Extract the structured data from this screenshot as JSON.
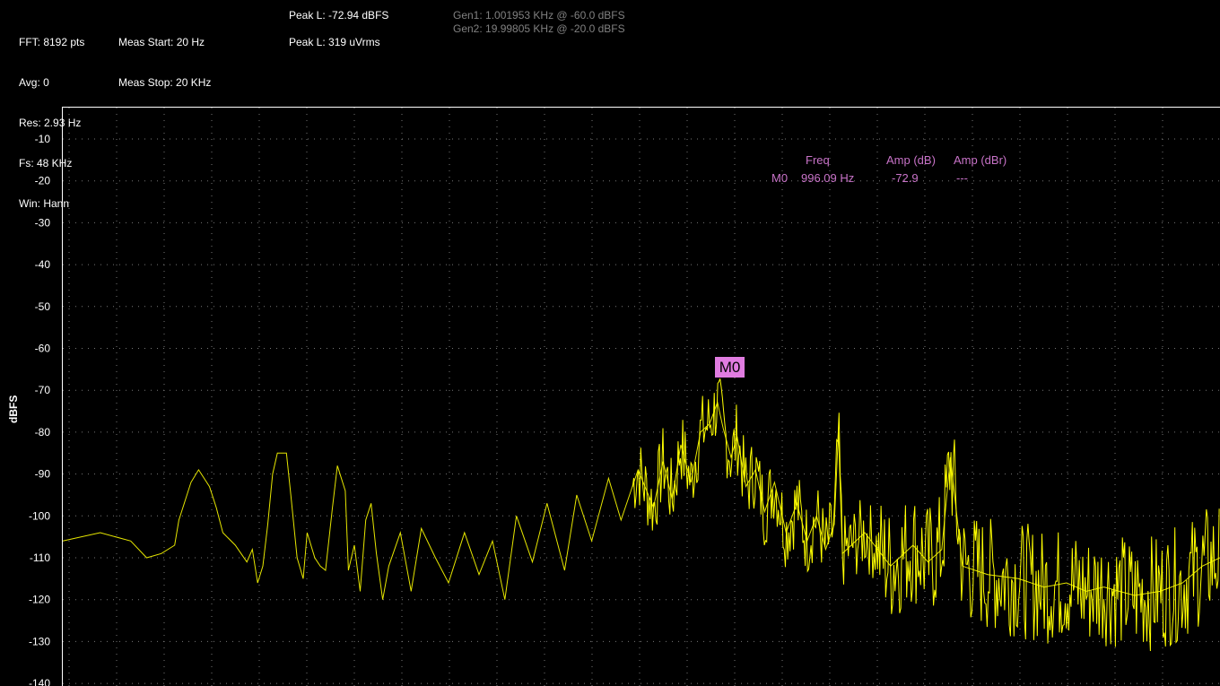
{
  "header": {
    "col1": [
      "FFT: 8192 pts",
      "Avg: 0",
      "Res: 2.93 Hz",
      "Fs: 48 KHz",
      "Win: Hann"
    ],
    "col2": [
      "Meas Start: 20 Hz",
      "Meas Stop: 20 KHz"
    ],
    "peak_dbfs": "Peak L: -72.94 dBFS",
    "peak_vrms": "Peak L: 319 uVrms",
    "gen1": "Gen1: 1.001953 KHz @ -60.0 dBFS",
    "gen2": "Gen2: 19.99805 KHz @ -20.0 dBFS"
  },
  "marker_table": {
    "h_freq": "Freq",
    "h_amp_db": "Amp (dB)",
    "h_amp_dbr": "Amp (dBr)",
    "row_id": "M0",
    "row_freq": "996.09 Hz",
    "row_amp_db": "-72.9",
    "row_amp_dbr": "---"
  },
  "marker_label": "M0",
  "chart_data": {
    "type": "line",
    "ylabel": "dBFS",
    "ylim": [
      -140,
      -2
    ],
    "x_scale": "log",
    "xlim_hz": [
      20,
      20000
    ],
    "y_ticks": [
      -10,
      -20,
      -30,
      -40,
      -50,
      -60,
      -70,
      -80,
      -90,
      -100,
      -110,
      -120,
      -130,
      -140
    ],
    "grid": true,
    "series": [
      {
        "color": "#ffff00",
        "points_hz_db": [
          [
            20,
            -106
          ],
          [
            25,
            -104
          ],
          [
            30,
            -106
          ],
          [
            33,
            -110
          ],
          [
            36,
            -109
          ],
          [
            39,
            -107
          ],
          [
            40,
            -101
          ],
          [
            43,
            -92
          ],
          [
            45,
            -89
          ],
          [
            48,
            -93
          ],
          [
            50,
            -98
          ],
          [
            52,
            -104
          ],
          [
            56,
            -107
          ],
          [
            60,
            -111
          ],
          [
            62,
            -108
          ],
          [
            64,
            -116
          ],
          [
            66,
            -112
          ],
          [
            68,
            -102
          ],
          [
            70,
            -90
          ],
          [
            72,
            -85
          ],
          [
            76,
            -85
          ],
          [
            78,
            -95
          ],
          [
            81,
            -110
          ],
          [
            84,
            -115
          ],
          [
            86,
            -104
          ],
          [
            90,
            -110
          ],
          [
            93,
            -112
          ],
          [
            96,
            -113
          ],
          [
            100,
            -98
          ],
          [
            103,
            -88
          ],
          [
            108,
            -94
          ],
          [
            110,
            -113
          ],
          [
            114,
            -107
          ],
          [
            118,
            -118
          ],
          [
            122,
            -101
          ],
          [
            126,
            -97
          ],
          [
            130,
            -109
          ],
          [
            135,
            -120
          ],
          [
            140,
            -112
          ],
          [
            150,
            -104
          ],
          [
            160,
            -118
          ],
          [
            170,
            -103
          ],
          [
            185,
            -110
          ],
          [
            200,
            -116
          ],
          [
            220,
            -104
          ],
          [
            240,
            -114
          ],
          [
            260,
            -106
          ],
          [
            280,
            -120
          ],
          [
            300,
            -100
          ],
          [
            330,
            -111
          ],
          [
            360,
            -97
          ],
          [
            400,
            -113
          ],
          [
            430,
            -95
          ],
          [
            470,
            -106
          ],
          [
            520,
            -91
          ],
          [
            560,
            -101
          ],
          [
            620,
            -89
          ],
          [
            680,
            -98
          ],
          [
            720,
            -87
          ],
          [
            760,
            -96
          ],
          [
            800,
            -83
          ],
          [
            850,
            -92
          ],
          [
            900,
            -80
          ],
          [
            950,
            -78
          ],
          [
            996,
            -72.9
          ],
          [
            1030,
            -79
          ],
          [
            1080,
            -86
          ],
          [
            1120,
            -81
          ],
          [
            1180,
            -93
          ],
          [
            1250,
            -89
          ],
          [
            1320,
            -99
          ],
          [
            1400,
            -92
          ],
          [
            1500,
            -104
          ],
          [
            1600,
            -97
          ],
          [
            1700,
            -106
          ],
          [
            1800,
            -100
          ],
          [
            1900,
            -108
          ],
          [
            2000,
            -102
          ],
          [
            2050,
            -80
          ],
          [
            2100,
            -109
          ],
          [
            2400,
            -104
          ],
          [
            2800,
            -112
          ],
          [
            3200,
            -107
          ],
          [
            3500,
            -111
          ],
          [
            3800,
            -108
          ],
          [
            4000,
            -86
          ],
          [
            4300,
            -112
          ],
          [
            5000,
            -114
          ],
          [
            6000,
            -115
          ],
          [
            7000,
            -117
          ],
          [
            8000,
            -116
          ],
          [
            9000,
            -118
          ],
          [
            10000,
            -117
          ],
          [
            12000,
            -119
          ],
          [
            14000,
            -118
          ],
          [
            16000,
            -116
          ],
          [
            18000,
            -112
          ],
          [
            20000,
            -110
          ]
        ]
      }
    ],
    "annotations": [
      {
        "label": "M0",
        "x_hz": 996.09,
        "y_db": -72.9
      }
    ]
  }
}
